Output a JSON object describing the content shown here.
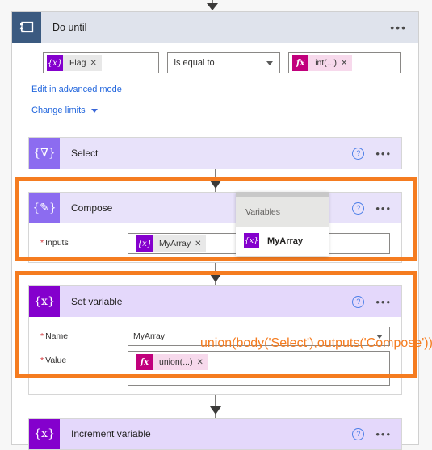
{
  "window": {
    "background": "#f7f7f7"
  },
  "do_until": {
    "icon": "loop-icon",
    "title": "Do until",
    "header_bg": "#dfe3ec",
    "icon_bg": "#3b5a80",
    "ellipsis": "•••",
    "condition": {
      "left_token": {
        "icon": "{x}",
        "label": "Flag",
        "remove": "✕",
        "icon_color": "#8400cd",
        "chip_color": "#e8e8e8"
      },
      "operator": {
        "value": "is equal to",
        "chevron": "chevron-down-icon"
      },
      "right_token": {
        "icon": "fx",
        "label": "int(...)",
        "remove": "✕",
        "icon_color": "#c1007c",
        "chip_color": "#f7d9ec"
      }
    },
    "links": {
      "advanced_mode": "Edit in advanced mode",
      "change_limits": "Change limits",
      "link_color": "#2266dd"
    }
  },
  "actions": [
    {
      "id": "select",
      "icon": "{∇}",
      "icon_bg": "#8c6cf0",
      "title": "Select",
      "help": "?",
      "ellipsis": "•••",
      "highlighted": false
    },
    {
      "id": "compose",
      "icon": "{✎}",
      "icon_bg": "#8c6cf0",
      "title": "Compose",
      "help": "?",
      "ellipsis": "•••",
      "highlighted": true,
      "fields": [
        {
          "label": "Inputs",
          "required": true,
          "token": {
            "icon": "{x}",
            "label": "MyArray",
            "remove": "✕",
            "icon_color": "#8400cd",
            "chip_color": "#e8e8e8"
          }
        }
      ]
    },
    {
      "id": "set-variable",
      "icon": "{x}",
      "icon_bg": "#8400cd",
      "title": "Set variable",
      "help": "?",
      "ellipsis": "•••",
      "highlighted": true,
      "fields": [
        {
          "label": "Name",
          "required": true,
          "value": "MyArray",
          "chevron": "chevron-down-icon"
        },
        {
          "label": "Value",
          "required": true,
          "token": {
            "icon": "fx",
            "label": "union(...)",
            "remove": "✕",
            "icon_color": "#c1007c",
            "chip_color": "#f7d9ec"
          }
        }
      ]
    },
    {
      "id": "increment-variable",
      "icon": "{x}",
      "icon_bg": "#8400cd",
      "title": "Increment variable",
      "help": "?",
      "ellipsis": "•••",
      "highlighted": false
    }
  ],
  "flyout": {
    "header": "Variables",
    "items": [
      {
        "icon": "{x}",
        "label": "MyArray",
        "icon_color": "#8400cd"
      }
    ]
  },
  "annotation": {
    "text": "union(body('Select'),outputs('Compose'))",
    "color": "#f57c20"
  },
  "highlight_color": "#f57c20"
}
